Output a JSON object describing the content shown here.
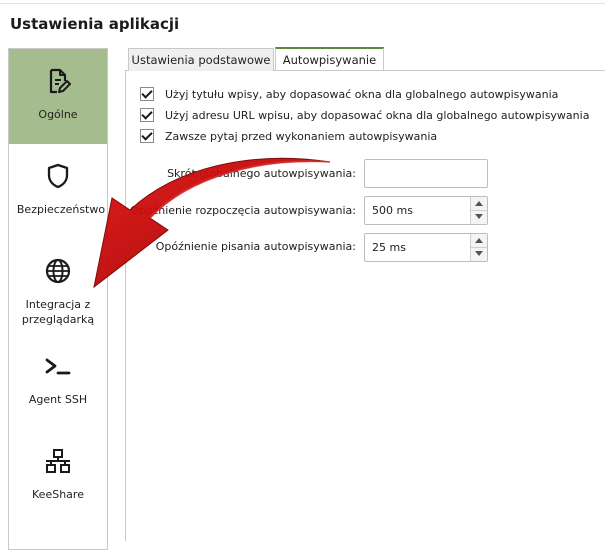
{
  "page": {
    "title": "Ustawienia aplikacji"
  },
  "sidebar": {
    "items": [
      {
        "label": "Ogólne",
        "icon": "edit-document-icon",
        "active": true
      },
      {
        "label": "Bezpieczeństwo",
        "icon": "shield-icon",
        "active": false
      },
      {
        "label": "Integracja z\nprzeglądarką",
        "label_line1": "Integracja z",
        "label_line2": "przeglądarką",
        "icon": "globe-icon",
        "active": false
      },
      {
        "label": "Agent SSH",
        "icon": "terminal-icon",
        "active": false
      },
      {
        "label": "KeeShare",
        "icon": "network-icon",
        "active": false
      }
    ]
  },
  "tabs": [
    {
      "label": "Ustawienia podstawowe",
      "active": false
    },
    {
      "label": "Autowpisywanie",
      "active": true
    }
  ],
  "autotype": {
    "options": [
      {
        "label": "Użyj tytułu wpisy, aby dopasować okna dla globalnego autowpisywania",
        "checked": true
      },
      {
        "label": "Użyj adresu URL wpisu, aby dopasować okna dla globalnego autowpisywania",
        "checked": true
      },
      {
        "label": "Zawsze pytaj przed wykonaniem autowpisywania",
        "checked": true
      }
    ],
    "shortcut_label": "Skrót globalnego autowpisywania:",
    "shortcut_value": "",
    "start_delay_label": "Opóźnienie rozpoczęcia autowpisywania:",
    "start_delay_value": "500 ms",
    "typing_delay_label": "Opóźnienie pisania autowpisywania:",
    "typing_delay_value": "25 ms"
  },
  "colors": {
    "active_sidebar": "#a5bd8e",
    "tab_accent": "#5a8a3a",
    "arrow": "#c40000"
  }
}
